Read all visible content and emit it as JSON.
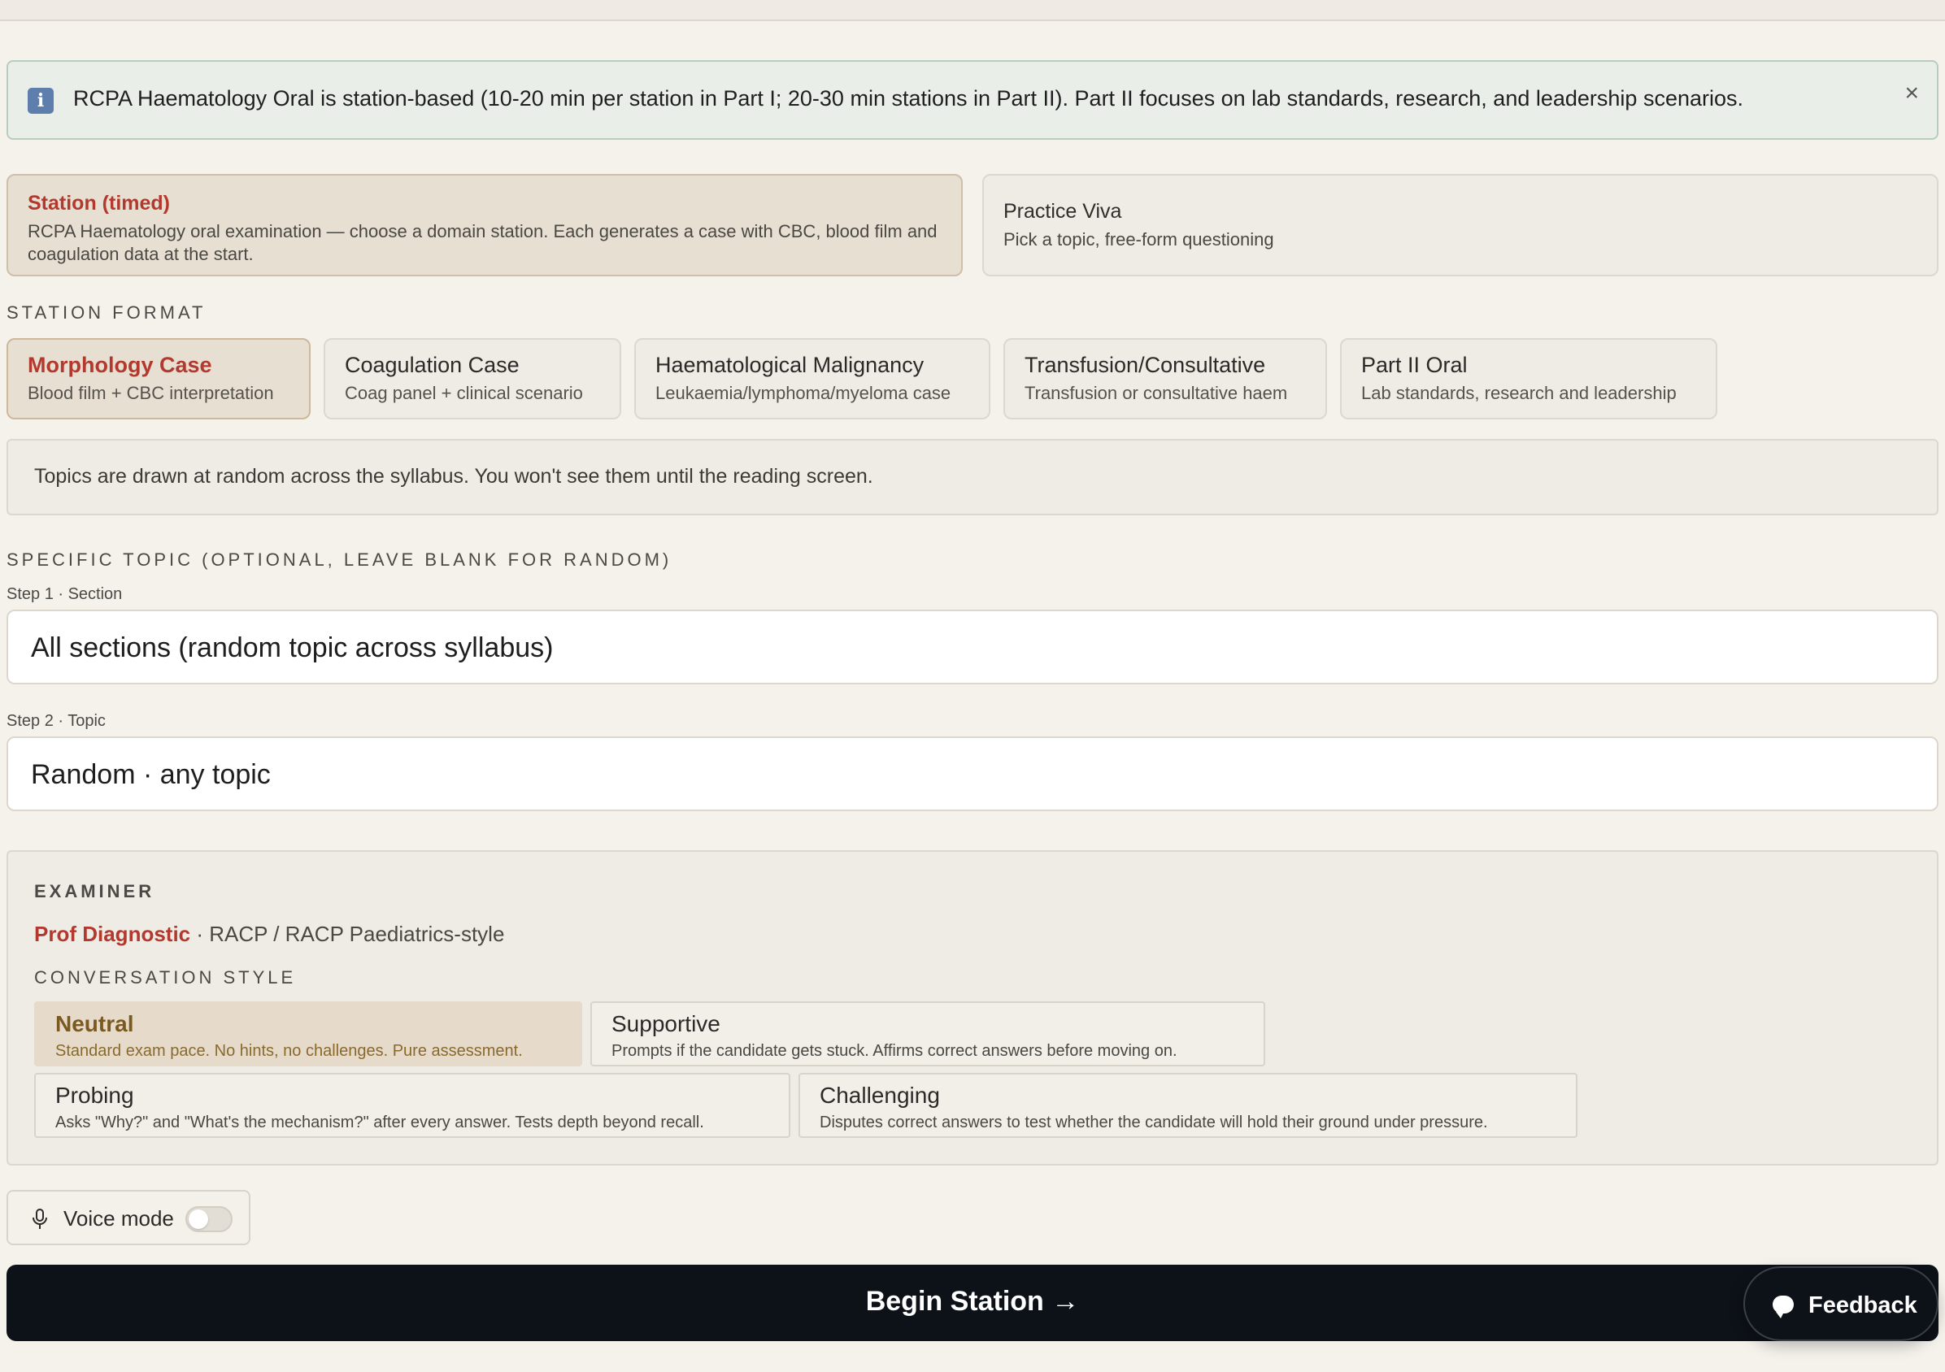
{
  "banner": {
    "icon": "info-icon",
    "text": "RCPA Haematology Oral is station-based (10-20 min per station in Part I; 20-30 min stations in Part II). Part II focuses on lab standards, research, and leadership scenarios.",
    "close": "×"
  },
  "modes": [
    {
      "title": "Station (timed)",
      "desc": "RCPA Haematology oral examination — choose a domain station. Each generates a case with CBC, blood film and coagulation data at the start.",
      "selected": true
    },
    {
      "title": "Practice Viva",
      "desc": "Pick a topic, free-form questioning",
      "selected": false
    }
  ],
  "station_format": {
    "label": "STATION FORMAT",
    "options": [
      {
        "title": "Morphology Case",
        "subtitle": "Blood film + CBC interpretation",
        "selected": true
      },
      {
        "title": "Coagulation Case",
        "subtitle": "Coag panel + clinical scenario",
        "selected": false
      },
      {
        "title": "Haematological Malignancy",
        "subtitle": "Leukaemia/lymphoma/myeloma case",
        "selected": false
      },
      {
        "title": "Transfusion/Consultative",
        "subtitle": "Transfusion or consultative haem",
        "selected": false
      },
      {
        "title": "Part II Oral",
        "subtitle": "Lab standards, research and leadership",
        "selected": false
      }
    ]
  },
  "notice": "Topics are drawn at random across the syllabus. You won't see them until the reading screen.",
  "specific_topic": {
    "label": "SPECIFIC TOPIC (OPTIONAL, LEAVE BLANK FOR RANDOM)",
    "step1_label": "Step 1 · Section",
    "step1_value": "All sections (random topic across syllabus)",
    "step2_label": "Step 2 · Topic",
    "step2_value": "Random · any topic"
  },
  "examiner": {
    "heading": "EXAMINER",
    "name": "Prof Diagnostic",
    "style_suffix": " · RACP / RACP Paediatrics-style",
    "conversation_label": "CONVERSATION STYLE",
    "styles": [
      {
        "title": "Neutral",
        "desc": "Standard exam pace. No hints, no challenges. Pure assessment.",
        "selected": true
      },
      {
        "title": "Supportive",
        "desc": "Prompts if the candidate gets stuck. Affirms correct answers before moving on.",
        "selected": false
      },
      {
        "title": "Probing",
        "desc": "Asks \"Why?\" and \"What's the mechanism?\" after every answer. Tests depth beyond recall.",
        "selected": false
      },
      {
        "title": "Challenging",
        "desc": "Disputes correct answers to test whether the candidate will hold their ground under pressure.",
        "selected": false
      }
    ]
  },
  "voice_mode": {
    "label": "Voice mode",
    "icon": "microphone-icon",
    "enabled": false
  },
  "begin_button": "Begin Station →",
  "feedback_button": {
    "label": "Feedback",
    "icon": "chat-bubble-icon"
  },
  "colors": {
    "accent_red": "#b3392e",
    "dark_button": "#0d1118",
    "selected_card": "#e8dfd3",
    "neutral_gold": "#7a5a20"
  }
}
